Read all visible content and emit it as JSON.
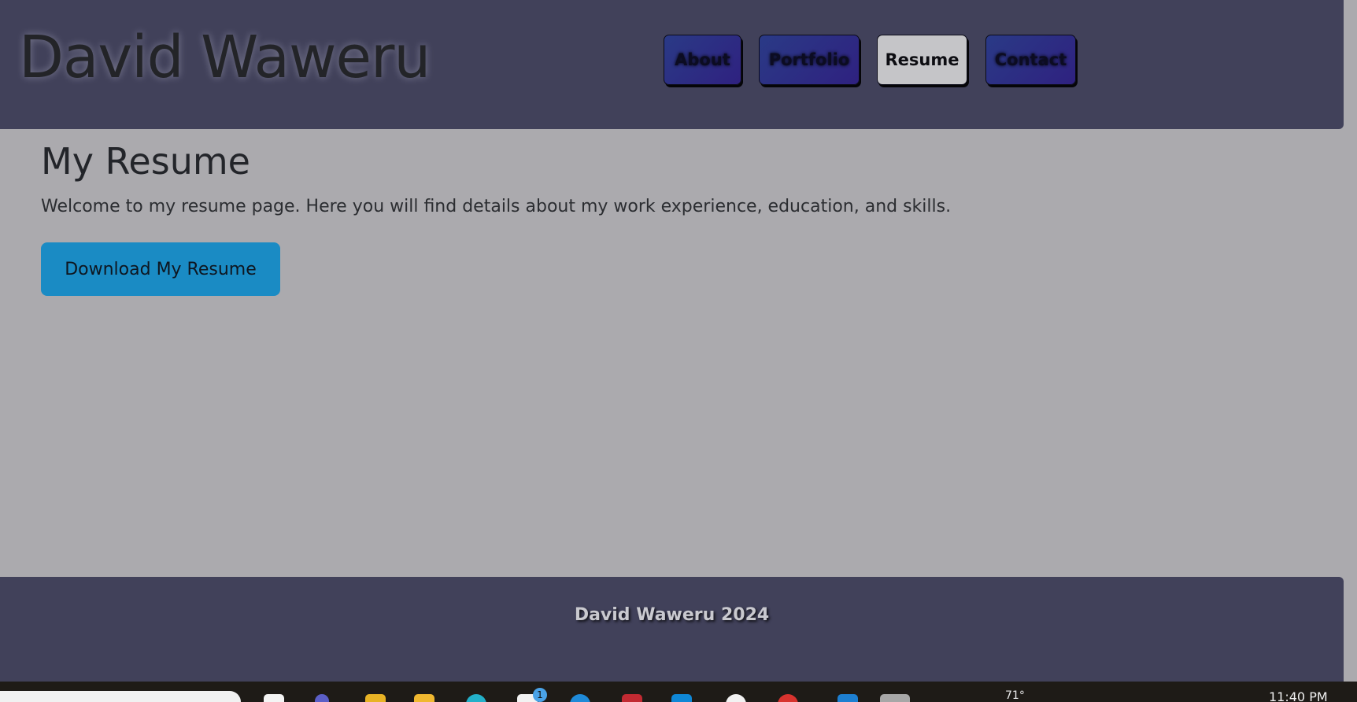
{
  "header": {
    "site_title": "David Waweru",
    "nav": [
      {
        "label": "About",
        "active": false
      },
      {
        "label": "Portfolio",
        "active": false
      },
      {
        "label": "Resume",
        "active": true
      },
      {
        "label": "Contact",
        "active": false
      }
    ]
  },
  "main": {
    "heading": "My Resume",
    "intro": "Welcome to my resume page. Here you will find details about my work experience, education, and skills.",
    "download_label": "Download My Resume"
  },
  "footer": {
    "text": "David Waweru 2024"
  },
  "taskbar": {
    "weather": "71°",
    "clock": "11:40 PM",
    "notification_badge": "1"
  },
  "colors": {
    "header_bg": "#41415a",
    "page_bg": "#abaaae",
    "download_button": "#1a8bc4",
    "nav_button": "#2f2a86",
    "nav_active": "#c5c5c8"
  }
}
